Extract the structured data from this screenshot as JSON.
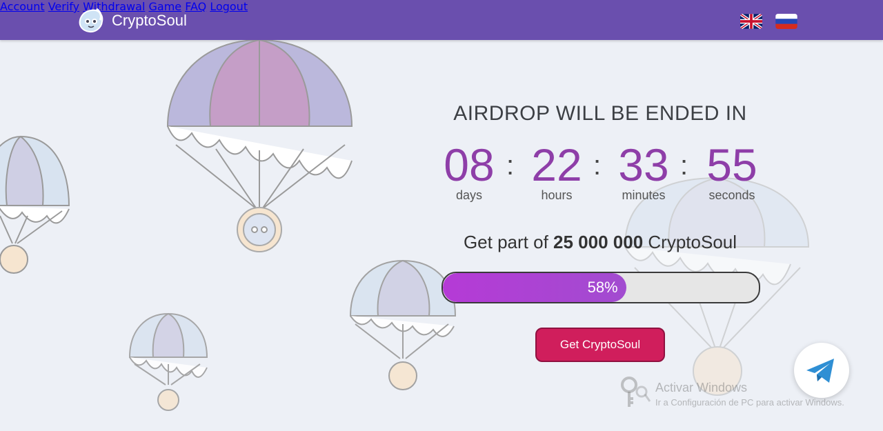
{
  "header": {
    "brand": "CryptoSoul",
    "nav": [
      {
        "label": "Account"
      },
      {
        "label": "Verify"
      },
      {
        "label": "Withdrawal"
      },
      {
        "label": "Game"
      },
      {
        "label": "FAQ"
      },
      {
        "label": "Logout"
      }
    ],
    "languages": [
      {
        "icon": "uk-flag-icon"
      },
      {
        "icon": "russia-flag-icon"
      }
    ]
  },
  "countdown": {
    "title": "AIRDROP WILL BE ENDED IN",
    "days": {
      "value": "08",
      "label": "days"
    },
    "hours": {
      "value": "22",
      "label": "hours"
    },
    "minutes": {
      "value": "33",
      "label": "minutes"
    },
    "seconds": {
      "value": "55",
      "label": "seconds"
    }
  },
  "offer": {
    "prefix": "Get part of",
    "amount": "25 000 000",
    "suffix": "CryptoSoul"
  },
  "progress": {
    "percent": 58,
    "label": "58%"
  },
  "cta": {
    "label": "Get CryptoSoul"
  },
  "telegram": {
    "icon": "telegram-icon"
  },
  "overlay": {
    "line1": "Activar Windows",
    "line2": "Ir a Configuración de PC para activar Windows."
  },
  "colors": {
    "header": "#6a4fae",
    "accent": "#8e3ea8",
    "cta": "#d01e5c",
    "background": "#edf0f6"
  }
}
